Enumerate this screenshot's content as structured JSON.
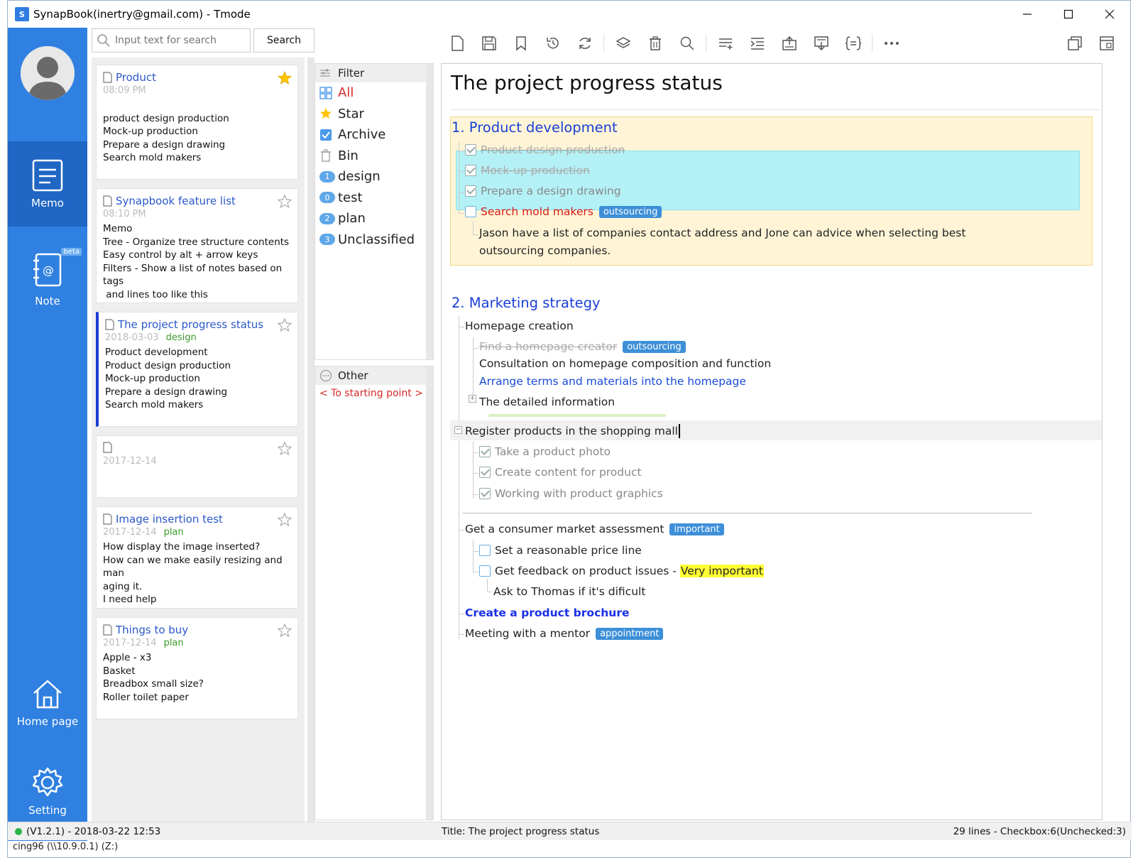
{
  "window": {
    "title": "SynapBook(inertry@gmail.com) - Tmode",
    "app_icon": "S"
  },
  "nav": {
    "items": [
      {
        "label": "Memo",
        "icon": "memo-icon"
      },
      {
        "label": "Note",
        "icon": "note-icon",
        "badge": "beta"
      },
      {
        "label": "Home page",
        "icon": "home-icon"
      },
      {
        "label": "Setting",
        "icon": "gear-icon"
      }
    ]
  },
  "search": {
    "placeholder": "Input text for search",
    "button": "Search"
  },
  "memos": [
    {
      "title": "Product",
      "time": "08:09 PM",
      "tag": "",
      "starred": true,
      "lines": [
        "",
        "product design production",
        "Mock-up production",
        "Prepare a design drawing",
        "Search mold makers"
      ]
    },
    {
      "title": "Synapbook feature list",
      "time": "08:10 PM",
      "tag": "",
      "starred": false,
      "lines": [
        "Memo",
        "Tree - Organize tree structure contents",
        "Easy control by alt + arrow keys",
        "Filters - Show a list of notes based on tags",
        " and lines too like this"
      ]
    },
    {
      "title": "The project progress status",
      "time": "2018-03-03",
      "tag": "design",
      "starred": false,
      "lines": [
        "Product development",
        "Product design production",
        "Mock-up production",
        "Prepare a design drawing",
        "Search mold makers"
      ]
    },
    {
      "title": "",
      "time": "2017-12-14",
      "tag": "",
      "starred": false,
      "lines": []
    },
    {
      "title": "Image insertion test",
      "time": "2017-12-14",
      "tag": "plan",
      "starred": false,
      "lines": [
        "How display the image inserted?",
        "How can we make easily resizing and man",
        "aging it.",
        "I need help"
      ]
    },
    {
      "title": "Things to buy",
      "time": "2017-12-14",
      "tag": "plan",
      "starred": false,
      "lines": [
        "Apple - x3",
        "Basket",
        "Breadbox small size?",
        "Roller toilet paper"
      ]
    }
  ],
  "filter": {
    "header": "Filter",
    "items": [
      {
        "label": "All",
        "icon": "grid-icon"
      },
      {
        "label": "Star",
        "icon": "star-icon"
      },
      {
        "label": "Archive",
        "icon": "archive-check-icon"
      },
      {
        "label": "Bin",
        "icon": "bin-icon"
      },
      {
        "label": "design",
        "count": "1"
      },
      {
        "label": "test",
        "count": "0"
      },
      {
        "label": "plan",
        "count": "2"
      },
      {
        "label": "Unclassified",
        "count": "3"
      }
    ],
    "other_header": "Other",
    "starting_point": "< To starting point >"
  },
  "editor": {
    "title": "The project progress status",
    "section1_heading": "1. Product development",
    "s1_items": [
      "Product design production",
      "Mock-up production",
      "Prepare a design drawing",
      "Search mold makers"
    ],
    "s1_tag": "outsourcing",
    "s1_note_1": "Jason have a list of companies contact address and Jone can advice when selecting best",
    "s1_note_2": "outsourcing companies.",
    "section2_heading": "2. Marketing strategy",
    "homepage": "Homepage creation",
    "find_creator": "Find a homepage creator",
    "find_tag": "outsourcing",
    "consultation": "Consultation on homepage composition and function",
    "arrange": "Arrange terms and materials into the homepage",
    "detailed": "The detailed information",
    "register": "Register products in the shopping mall",
    "photo": "Take a product photo",
    "content": "Create content for product",
    "graphics": "Working with product graphics",
    "assessment": "Get a consumer market assessment",
    "assessment_tag": "important",
    "price": "Set a reasonable price line",
    "feedback": "Get feedback on product issues - ",
    "feedback_hl": "Very important",
    "ask": "Ask to Thomas if it's dificult",
    "brochure": "Create a product brochure",
    "mentor": "Meeting with a mentor",
    "mentor_tag": "appointment"
  },
  "status": {
    "version": "(V1.2.1) - 2018-03-22 12:53",
    "title": "Title: The project progress status",
    "counts": "29 lines - Checkbox:6(Unchecked:3)",
    "outer": "cing96 (\\\\10.9.0.1) (Z:)"
  }
}
